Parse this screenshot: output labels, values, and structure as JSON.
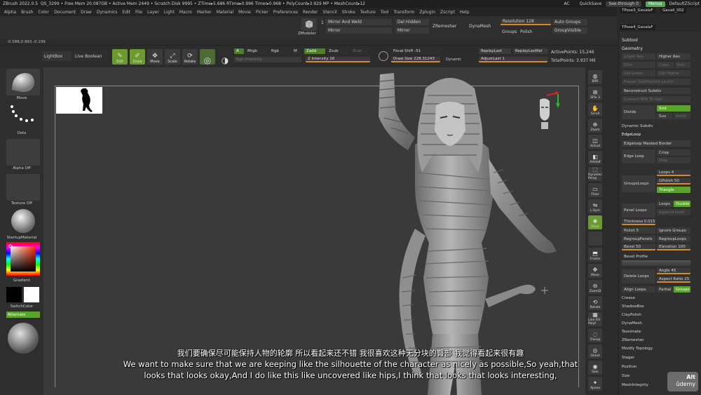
{
  "titlebar": {
    "app": "ZBrush 2022.0.5",
    "doc": "QS_3299",
    "free_mem": "• Free Mem 20.087GB",
    "active_mem": "• Active Mem 2449",
    "scratch": "• Scratch Disk 9995",
    "ztime": "• ZTime▸5.686 RTime▸0.996 Timer▸0.968",
    "polycount": "• PolyCount▸3.929 MP",
    "meshcount": "• MeshCount▸12",
    "ac": "AC",
    "quicksave": "QuickSave",
    "seethrough": "See-through  0",
    "menus": "Menus",
    "script": "DefaultZScript"
  },
  "menus": [
    "Alpha",
    "Brush",
    "Color",
    "Document",
    "Draw",
    "Dynamics",
    "Edit",
    "File",
    "Layer",
    "Light",
    "Macro",
    "Marker",
    "Material",
    "Movie",
    "Picker",
    "Preferences",
    "Render",
    "Stencil",
    "Stroke",
    "Texture",
    "Tool",
    "Transform",
    "Zplugin",
    "Zscript",
    "Help"
  ],
  "tabs": [
    "TPose3_GavalaF",
    "GavalI_002",
    "TPose4_GavalaF"
  ],
  "shelf": {
    "zmodeler": "ZModeler",
    "mirror_weld_num": "1",
    "mirror_and_weld": "Mirror And Weld",
    "mirror": "Mirror",
    "del_hidden": "Del Hidden",
    "mirror2": "Mirror",
    "zremesher": "ZRemesher",
    "dynamesh": "DynaMesh",
    "resolution": "Resolution 128",
    "groups": "Groups",
    "polish": "Polish",
    "auto_groups": "Auto Groups",
    "group_visible": "GroupVisible",
    "coords": "-0.588,0.993,-0.199"
  },
  "toolbar": {
    "lightbox": "LightBox",
    "live_boolean": "Live Boolean",
    "edit": "Edit",
    "draw": "Draw",
    "move": "Move",
    "scale": "Scale",
    "rotate": "Rotate",
    "a": "A",
    "mrgb": "Mrgb",
    "rgb": "Rgb",
    "m": "M",
    "rgb_intensity": "Rgb Intensity",
    "zadd": "Zadd",
    "zsub": "Zsub",
    "zcut": "Zcut",
    "z_intensity": "Z Intensity 16",
    "focal_shift": "Focal Shift -51",
    "draw_size": "Draw Size 228.31243",
    "dynamic": "Dynamic",
    "replay_last": "ReplayLast",
    "replay_last_rel": "ReplayLastRel",
    "adjust_last": "AdjustLast  1",
    "active_points": "ActivePoints: 15,246",
    "total_points": "TotalPoints: 3.937 Mil"
  },
  "leftpanel": {
    "move": "Move",
    "dots": "Dots",
    "alpha_off": "Alpha Off",
    "texture_off": "Texture Off",
    "startup_material": "StartupMaterial",
    "gradient": "Gradient",
    "switch_color": "SwitchColor",
    "alternate": "Alternate"
  },
  "righticons": [
    "BPR",
    "SPix 3",
    "Scroll",
    "Zoom",
    "Actual",
    "AAHalf",
    "Dynamic Persp",
    "Floor",
    "L.Sym",
    "Gxyz",
    "",
    "Frame",
    "Move",
    "ZoomD",
    "Rotate",
    "Line Fill PolyF",
    "Transp",
    "Ghost",
    "Solo",
    "Xpose"
  ],
  "rightpanel": {
    "subtool_head": "Subtool",
    "geometry": "Geometry",
    "lower_res": "Lower Res",
    "higher_res": "Higher Res",
    "sdiv": "SDiv",
    "cage": "Cage",
    "rstr": "Rstr",
    "del_lower": "Del Lower",
    "del_higher": "Del Higher",
    "freeze_subdiv": "Freeze SubDivision Levels",
    "reconstruct": "Reconstruct Subdiv",
    "convert_bpr": "Convert BPR To Geo",
    "divide": "Divide",
    "smt": "Smt",
    "suv": "Suv",
    "reuv": "ReUV",
    "dynamic_subdiv": "Dynamic Subdiv",
    "edgeloop": "EdgeLoop",
    "edgeloop_masked": "Edgeloop Masked Border",
    "edge_loop": "Edge Loop",
    "crisp": "Crisp",
    "disp": "Disp",
    "loops4": "Loops 4",
    "gpolish": "GPolish 50",
    "grouploops": "GroupsLoops",
    "triangle": "Triangle",
    "loops": "Loops",
    "double": "Double",
    "append_inset": "Append Inset",
    "panel_loops": "Panel Loops",
    "thickness": "Thickness 0.015",
    "polish5": "Polish 5",
    "ignore_groups": "Ignore Groups",
    "regroup_panels": "RegroupPanels",
    "regroup_loops": "RegroupLoops",
    "bevel": "Bevel 50",
    "elevation": "Elevation 100",
    "bevel_profile": "Bevel Profile",
    "delete_loops": "Delete Loops",
    "angle": "Angle 45",
    "aspect_ratio": "Aspect Ratio 25",
    "align_loops": "Align Loops",
    "partial": "Partial",
    "groups": "Groups",
    "crease": "Crease",
    "shadowbox": "ShadowBox",
    "claypolish": "ClayPolish",
    "dynamesh": "DynaMesh",
    "tessimate": "Tessimate",
    "zremesher": "ZRemesher",
    "modify_topology": "Modify Topology",
    "stager": "Stager",
    "position": "Position",
    "size": "Size",
    "mesh_integrity": "MeshIntegrity"
  },
  "subtitles": {
    "cn": "我们要确保尽可能保持人物的轮廓 所以看起来还不错 我很喜欢这种无分块的臀部 我觉得看起来很有趣",
    "en1": "We want to make sure that we are keeping like the silhouette of the character as nicely as possible,So yeah,that",
    "en2": "looks that looks okay,And I do like this like uncovered like hips,I think that looks that looks interesting,"
  },
  "udemy": {
    "alt": "Alt",
    "brand": "ûdemy"
  },
  "colors": {
    "accent_green": "#6b9b2e",
    "orange": "#d8882c",
    "viewport_bg": "#3a3a3a"
  }
}
